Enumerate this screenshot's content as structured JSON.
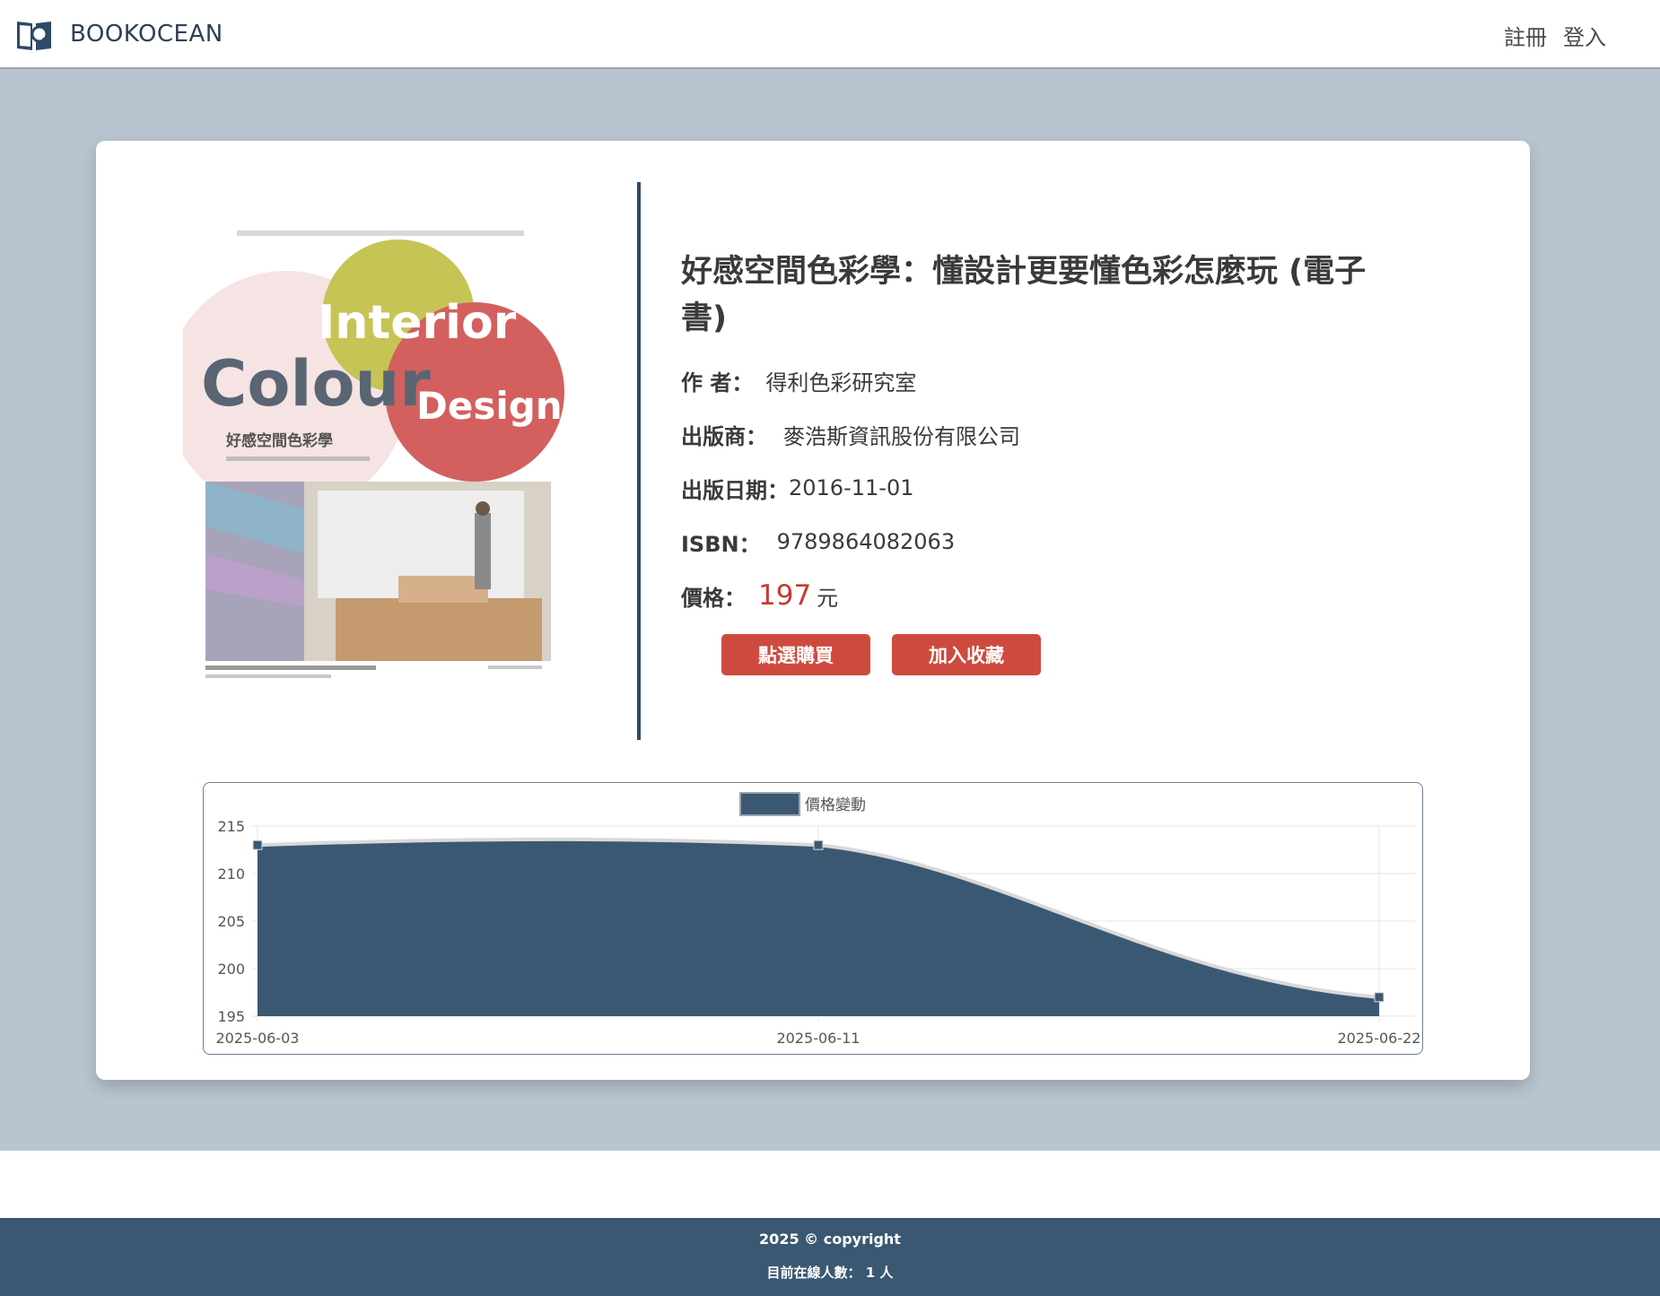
{
  "header": {
    "brand": "BOOKOCEAN",
    "nav": {
      "register": "註冊",
      "login": "登入"
    }
  },
  "book": {
    "title": "好感空間色彩學：懂設計更要懂色彩怎麼玩 (電子書)",
    "author_label": "作 者：",
    "author": "得利色彩研究室",
    "publisher_label": "出版商：",
    "publisher": "麥浩斯資訊股份有限公司",
    "date_label": "出版日期：",
    "date": "2016-11-01",
    "isbn_label": "ISBN：",
    "isbn": "9789864082063",
    "price_label": "價格：",
    "price": "197",
    "price_unit": "元",
    "cover": {
      "word1": "Interior",
      "word2": "Colour",
      "word3": "Design",
      "subtitle": "好感空間色彩學"
    }
  },
  "actions": {
    "buy": "點選購買",
    "favorite": "加入收藏"
  },
  "colors": {
    "accent": "#cf4a3e",
    "series": "#3b5873",
    "price": "#c63a31"
  },
  "chart_data": {
    "type": "area",
    "x": [
      "2025-06-03",
      "2025-06-11",
      "2025-06-22"
    ],
    "series": [
      {
        "name": "價格變動",
        "values": [
          213,
          213,
          197
        ]
      }
    ],
    "ylim": [
      195,
      215
    ],
    "yticks": [
      215,
      210,
      205,
      200,
      195
    ],
    "legend": "top-center",
    "grid": true
  },
  "footer": {
    "copyright": "2025 © copyright",
    "online": "目前在線人數： 1 人"
  }
}
